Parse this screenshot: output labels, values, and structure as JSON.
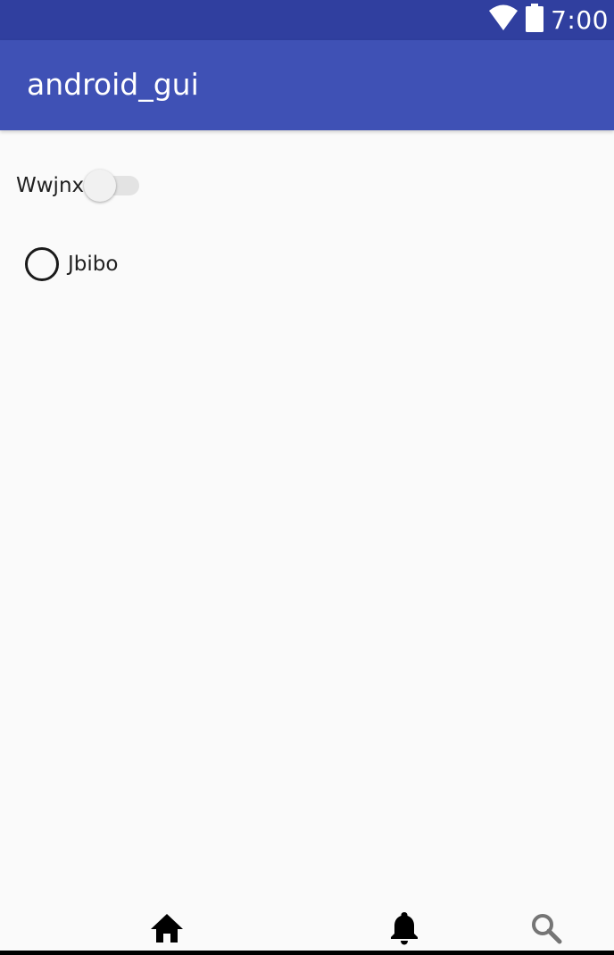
{
  "status_bar": {
    "time": "7:00",
    "icons": [
      "wifi-icon",
      "battery-icon"
    ],
    "background": "#303f9f"
  },
  "app_bar": {
    "title": "android_gui",
    "background": "#3f51b5"
  },
  "content": {
    "switch": {
      "label": "Wwjnx",
      "checked": false
    },
    "radio": {
      "label": "Jbibo",
      "checked": false
    }
  },
  "bottom_nav": {
    "items": [
      {
        "icon": "home-icon",
        "color": "#000000"
      },
      {
        "icon": "bell-icon",
        "color": "#000000"
      },
      {
        "icon": "search-icon",
        "color": "#757575"
      }
    ]
  }
}
